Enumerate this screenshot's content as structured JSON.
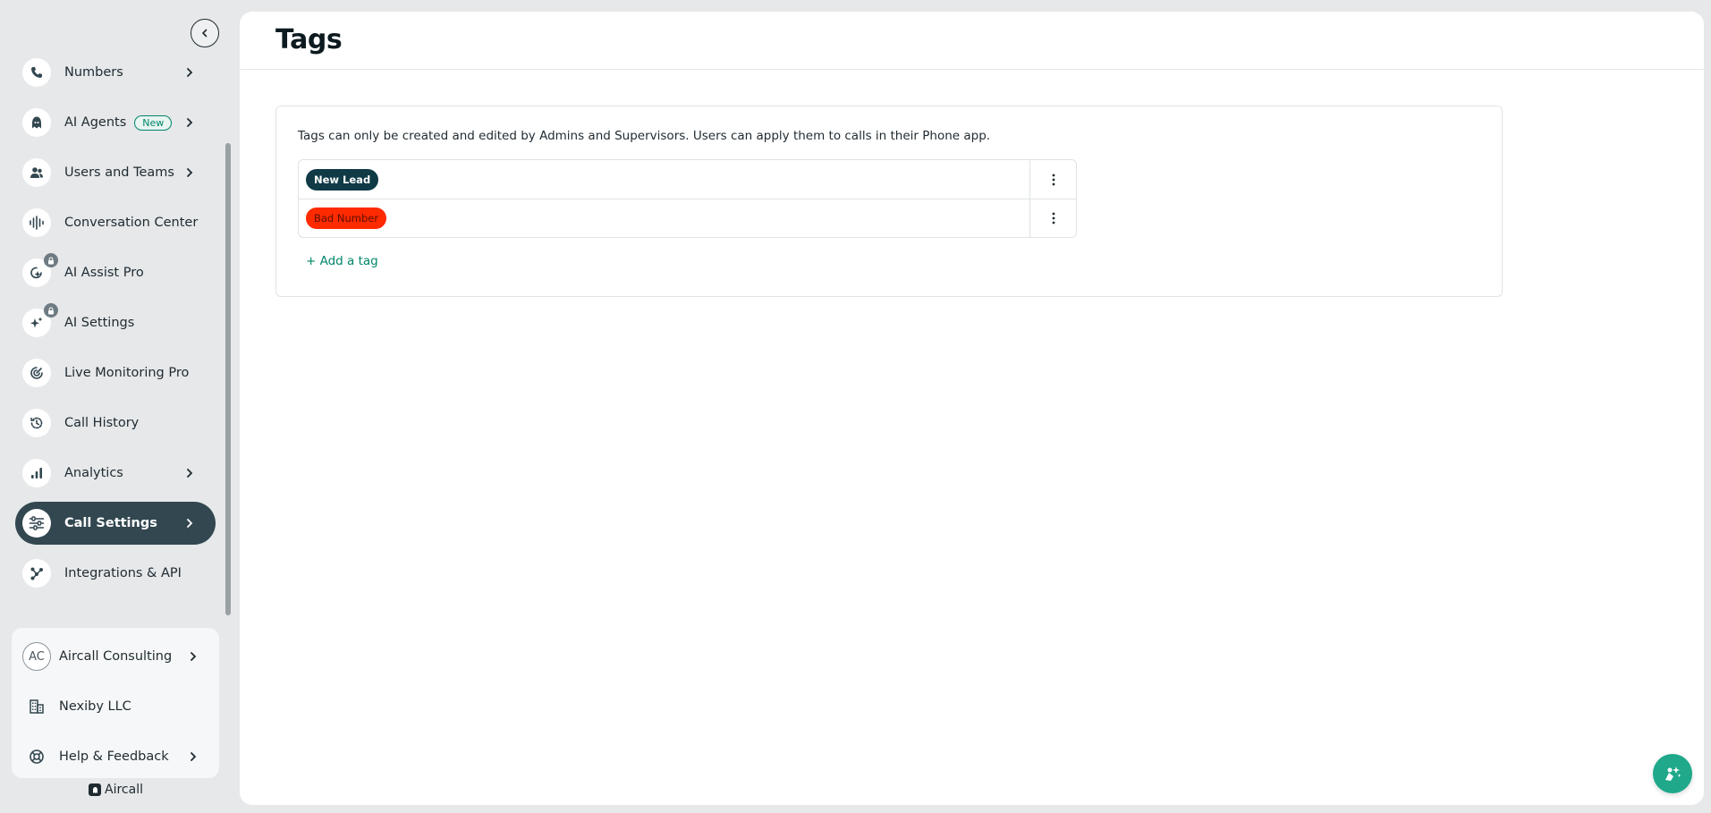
{
  "sidebar": {
    "items": [
      {
        "label": "Numbers",
        "icon": "phone-icon"
      },
      {
        "label": "AI Agents",
        "badge": "New",
        "icon": "ai-agent-icon"
      },
      {
        "label": "Users and Teams",
        "icon": "users-icon"
      },
      {
        "label": "Conversation Center",
        "icon": "waveform-icon"
      },
      {
        "label": "AI Assist Pro",
        "icon": "ai-assist-icon"
      },
      {
        "label": "AI Settings",
        "icon": "sparkle-icon"
      },
      {
        "label": "Live Monitoring Pro",
        "icon": "radar-icon"
      },
      {
        "label": "Call History",
        "icon": "history-icon"
      },
      {
        "label": "Analytics",
        "icon": "bar-chart-icon"
      },
      {
        "label": "Call Settings",
        "icon": "sliders-icon",
        "active": true
      },
      {
        "label": "Integrations & API",
        "icon": "integrations-icon"
      }
    ],
    "bottom": [
      {
        "label": "Aircall Consulting",
        "avatar": "AC"
      },
      {
        "label": "Nexiby LLC",
        "icon": "building-icon"
      },
      {
        "label": "Help & Feedback",
        "icon": "lifebuoy-icon"
      }
    ],
    "brand": "Aircall"
  },
  "main": {
    "title": "Tags",
    "info": "Tags can only be created and edited by Admins and Supervisors. Users can apply them to calls in their Phone app.",
    "tags": [
      {
        "label": "New Lead",
        "bg": "#0f3a46",
        "color": "#ffffff"
      },
      {
        "label": "Bad Number",
        "bg": "#ff2a00",
        "color": "#5a1000"
      }
    ],
    "add_tag": "+ Add a tag"
  },
  "colors": {
    "accent": "#00856a",
    "active_nav": "#324750",
    "fab": "#1fa98a"
  }
}
